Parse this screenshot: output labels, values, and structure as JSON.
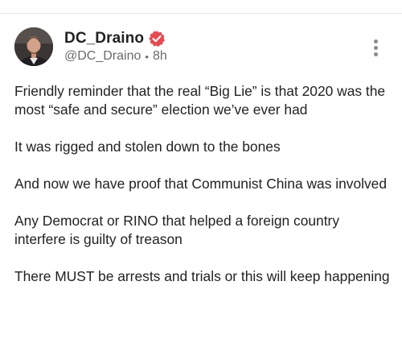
{
  "post": {
    "display_name": "DC_Draino",
    "handle": "@DC_Draino",
    "separator": "•",
    "time_ago": "8h",
    "verified": true,
    "badge_color": "#e8484f",
    "paragraphs": [
      "Friendly reminder that the real “Big Lie” is that 2020 was the most “safe and secure” election we’ve ever had",
      "It was rigged and stolen down to the bones",
      "And now we have proof that Communist China was involved",
      "Any Democrat or RINO that helped a foreign country interfere is guilty of treason",
      "There MUST be arrests and trials or this will keep happening"
    ]
  },
  "icons": {
    "avatar": "user-photo",
    "verified": "verified-badge-icon",
    "more": "more-vertical-icon"
  }
}
